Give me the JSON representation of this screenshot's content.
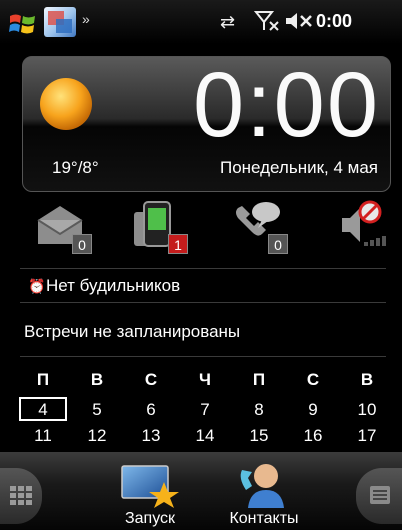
{
  "status_bar": {
    "time": "0:00",
    "more": "»",
    "icons": [
      "windows-start-icon",
      "app-icon",
      "sync-icon",
      "no-signal-icon",
      "mute-icon"
    ]
  },
  "clock": {
    "time": "0:00",
    "temperature": "19°/8°",
    "date": "Понедельник, 4 мая",
    "weather_icon": "sun-icon"
  },
  "notifications": [
    {
      "icon": "messages-icon",
      "count": "0",
      "badge_color": "#555555"
    },
    {
      "icon": "phone-sms-icon",
      "count": "1",
      "badge_color": "#c41c1c"
    },
    {
      "icon": "voicemail-icon",
      "count": "0",
      "badge_color": "#555555"
    },
    {
      "icon": "sound-off-icon"
    }
  ],
  "alarm": {
    "text": "Нет будильников",
    "icon": "alarm-clock-icon"
  },
  "appointments": {
    "text": "Встречи не запланированы"
  },
  "calendar": {
    "day_names": [
      "П",
      "В",
      "С",
      "Ч",
      "П",
      "С",
      "В"
    ],
    "week1": [
      "4",
      "5",
      "6",
      "7",
      "8",
      "9",
      "10"
    ],
    "week2": [
      "11",
      "12",
      "13",
      "14",
      "15",
      "16",
      "17"
    ],
    "today": "4"
  },
  "bottom_bar": {
    "launch_label": "Запуск",
    "contacts_label": "Контакты"
  },
  "colors": {
    "background": "#000000",
    "badge_red": "#c41c1c",
    "sun": "#f7a31c"
  }
}
